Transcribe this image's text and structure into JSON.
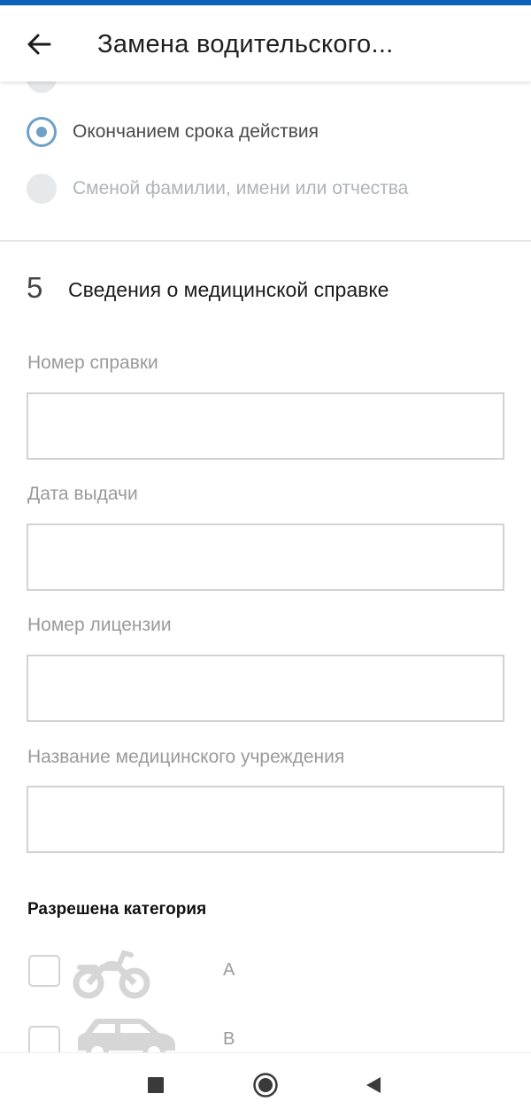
{
  "header": {
    "title": "Замена водительского..."
  },
  "reason": {
    "options": [
      {
        "label": "",
        "state": "disabled"
      },
      {
        "label": "Окончанием срока действия",
        "state": "checked"
      },
      {
        "label": "Сменой фамилии, имени или отчества",
        "state": "disabled"
      }
    ]
  },
  "section": {
    "number": "5",
    "title": "Сведения о медицинской справке"
  },
  "fields": [
    {
      "label": "Номер справки",
      "value": "",
      "placeholder": ""
    },
    {
      "label": "Дата выдачи",
      "value": "",
      "placeholder": ""
    },
    {
      "label": "Номер лицензии",
      "value": "",
      "placeholder": ""
    },
    {
      "label": "Название медицинского учреждения",
      "value": "",
      "placeholder": ""
    }
  ],
  "categories": {
    "heading": "Разрешена категория",
    "items": [
      {
        "letter": "A",
        "icon": "motorcycle-icon",
        "checked": false
      },
      {
        "letter": "B",
        "icon": "car-icon",
        "checked": false
      }
    ]
  },
  "colors": {
    "accent": "#0d63b5",
    "radio_checked": "#6fa0c6",
    "radio_disabled": "#e6e8ea",
    "disabled_text": "#aeb4b8",
    "label_text": "#9a9a9a",
    "input_border": "#d2d2d2"
  }
}
